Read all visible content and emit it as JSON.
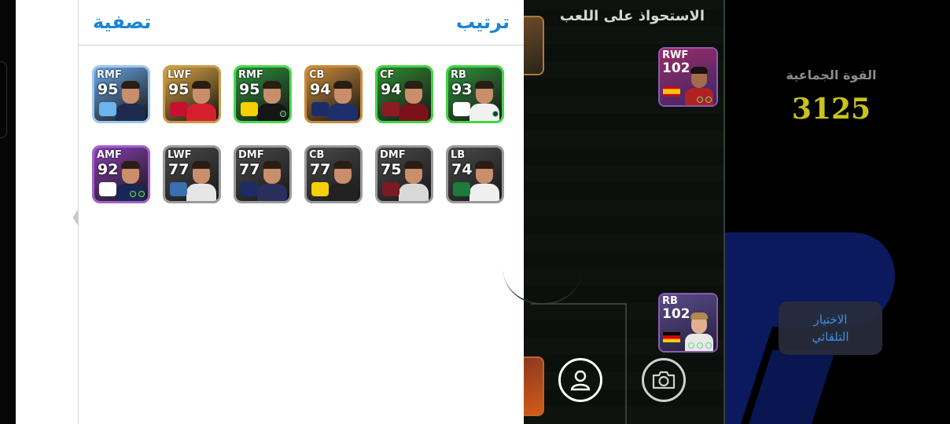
{
  "panel": {
    "filter_label": "تصفية",
    "sort_label": "ترتيب"
  },
  "back_icon": "chevron-left-icon",
  "player_cards": [
    {
      "position": "RMF",
      "rating": "95",
      "theme": "#6aa7e6",
      "border": "#9fc5ee",
      "kit": "#1d2b4f",
      "badge": "#6cb4ee"
    },
    {
      "position": "LWF",
      "rating": "95",
      "theme": "#d9a441",
      "border": "#c79a45",
      "kit": "#d61f2c",
      "badge": "#c8102e"
    },
    {
      "position": "RMF",
      "rating": "95",
      "theme": "#2c8f3a",
      "border": "#4cd84c",
      "kit": "#151515",
      "badge": "#f5d100"
    },
    {
      "position": "CB",
      "rating": "94",
      "theme": "#c98a3a",
      "border": "#c98a3a",
      "kit": "#1f2f6b",
      "badge": "#1b2c66"
    },
    {
      "position": "CF",
      "rating": "94",
      "theme": "#2f8a30",
      "border": "#44d444",
      "kit": "#7a1219",
      "badge": "#8b1d22"
    },
    {
      "position": "RB",
      "rating": "93",
      "theme": "#2e9038",
      "border": "#44d444",
      "kit": "#f1f1f1",
      "badge": "#ffffff"
    },
    {
      "position": "AMF",
      "rating": "92",
      "theme": "#8a3fb5",
      "border": "#a060cc",
      "kit": "#1a2654",
      "badge": "#ffffff"
    },
    {
      "position": "LWF",
      "rating": "77",
      "theme": "#4a4a4a",
      "border": "#9a9a9a",
      "kit": "#e6e6e6",
      "badge": "#3a6fb0"
    },
    {
      "position": "DMF",
      "rating": "77",
      "theme": "#4a4a4a",
      "border": "#9a9a9a",
      "kit": "#2a2f5a",
      "badge": "#1b2c66"
    },
    {
      "position": "CB",
      "rating": "77",
      "theme": "#4a4a4a",
      "border": "#9a9a9a",
      "kit": "#222222",
      "badge": "#f5d100"
    },
    {
      "position": "DMF",
      "rating": "75",
      "theme": "#4a4a4a",
      "border": "#9a9a9a",
      "kit": "#d8d8d8",
      "badge": "#7a1a22"
    },
    {
      "position": "LB",
      "rating": "74",
      "theme": "#4a4a4a",
      "border": "#9a9a9a",
      "kit": "#efefef",
      "badge": "#1d7a3a"
    }
  ],
  "field": {
    "title": "الاستحواذ على اللعب",
    "cards": [
      {
        "position": "RWF",
        "rating": "102",
        "flag": "spain"
      },
      {
        "position": "RB",
        "rating": "102",
        "flag": "germany"
      }
    ],
    "player_icon": "user-icon",
    "camera_icon": "camera-icon"
  },
  "team": {
    "label": "القوة الجماعية",
    "value": "3125",
    "auto_select": "الاختيار\nالتلقائي"
  }
}
